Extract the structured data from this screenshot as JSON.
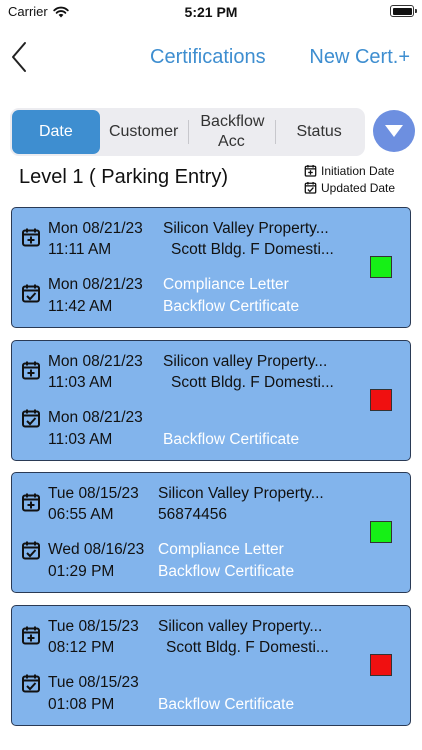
{
  "status_bar": {
    "carrier": "Carrier",
    "time": "5:21 PM"
  },
  "nav": {
    "title": "Certifications",
    "new_button": "New Cert.+"
  },
  "tabs": [
    {
      "label": "Date",
      "active": true
    },
    {
      "label": "Customer",
      "active": false
    },
    {
      "label": "Backflow Acc",
      "active": false
    },
    {
      "label": "Status",
      "active": false
    }
  ],
  "section": {
    "title": "Level 1 ( Parking Entry)"
  },
  "legend": {
    "initiation": "Initiation Date",
    "updated": "Updated Date"
  },
  "colors": {
    "accent": "#3e8ed0",
    "card_bg": "#82b4ec",
    "status_green": "#16f016",
    "status_red": "#f01010"
  },
  "cards": [
    {
      "initiated_date": "Mon 08/21/23",
      "initiated_time": "11:11 AM",
      "updated_date": "Mon 08/21/23",
      "updated_time": "11:42 AM",
      "customer": "Silicon Valley Property...",
      "location": "Scott Bldg. F Domesti...",
      "link1": "Compliance Letter",
      "link2": "Backflow Certificate",
      "status": "green"
    },
    {
      "initiated_date": "Mon 08/21/23",
      "initiated_time": "11:03 AM",
      "updated_date": "Mon 08/21/23",
      "updated_time": "11:03 AM",
      "customer": "Silicon valley Property...",
      "location": "Scott Bldg. F Domesti...",
      "link1": "",
      "link2": "Backflow Certificate",
      "status": "red"
    },
    {
      "initiated_date": "Tue 08/15/23",
      "initiated_time": "06:55 AM",
      "updated_date": "Wed 08/16/23",
      "updated_time": "01:29 PM",
      "customer": "Silicon Valley Property...",
      "location": "56874456",
      "link1": "Compliance Letter",
      "link2": "Backflow Certificate",
      "status": "green"
    },
    {
      "initiated_date": "Tue 08/15/23",
      "initiated_time": "08:12 PM",
      "updated_date": "Tue 08/15/23",
      "updated_time": "01:08 PM",
      "customer": "Silicon valley Property...",
      "location": "Scott Bldg. F Domesti...",
      "link1": "",
      "link2": "Backflow Certificate",
      "status": "red"
    }
  ]
}
